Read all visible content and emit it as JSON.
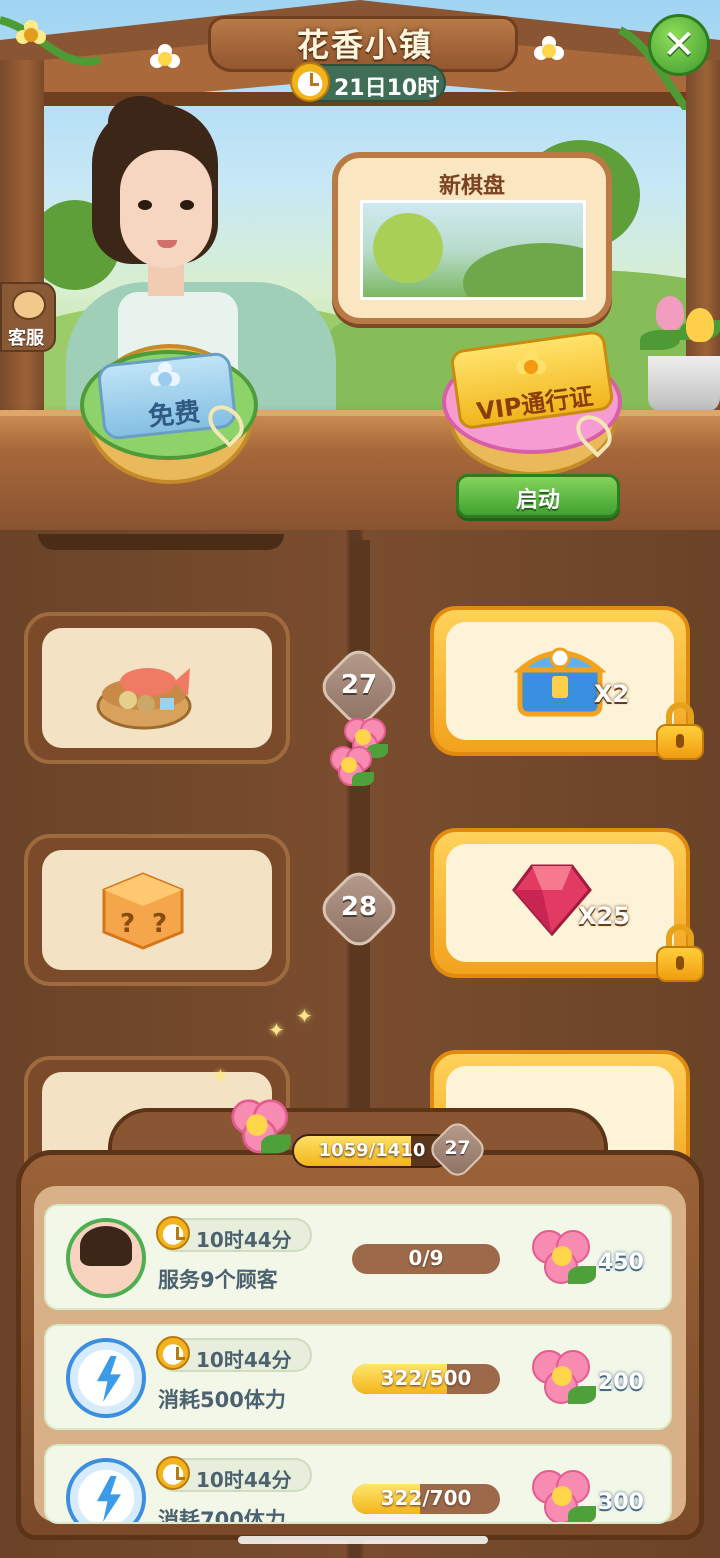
{
  "header": {
    "title": "花香小镇",
    "timer": "21日10时",
    "close_label": "✕"
  },
  "service": {
    "label": "客服"
  },
  "stands": {
    "free_label": "免费",
    "vip_label": "VIP通行证",
    "start_label": "启动"
  },
  "board": {
    "title": "新棋盘"
  },
  "track": {
    "rows": [
      {
        "level": "27",
        "free_item": "fish-basket-icon",
        "vip_item": "treasure-chest-icon",
        "vip_qty": "X2"
      },
      {
        "level": "28",
        "free_item": "mystery-box-icon",
        "vip_item": "ruby-gem-icon",
        "vip_qty": "X25"
      }
    ]
  },
  "panel": {
    "progress_text": "1059/1410",
    "progress_value": 0.75,
    "level": "27",
    "tasks": [
      {
        "time": "10时44分",
        "desc": "服务9个顾客",
        "progress": "0/9",
        "progress_value": 0,
        "reward": "450",
        "icon": "customer-avatar-icon"
      },
      {
        "time": "10时44分",
        "desc": "消耗500体力",
        "progress": "322/500",
        "progress_value": 0.644,
        "reward": "200",
        "icon": "energy-bolt-icon"
      },
      {
        "time": "10时44分",
        "desc": "消耗700体力",
        "progress": "322/700",
        "progress_value": 0.46,
        "reward": "300",
        "icon": "energy-bolt-icon"
      }
    ]
  },
  "colors": {
    "wood": "#7a4a2a",
    "vip_gold": "#f2a21d",
    "flower_pink": "#f78bb2",
    "go_green": "#41a130"
  }
}
